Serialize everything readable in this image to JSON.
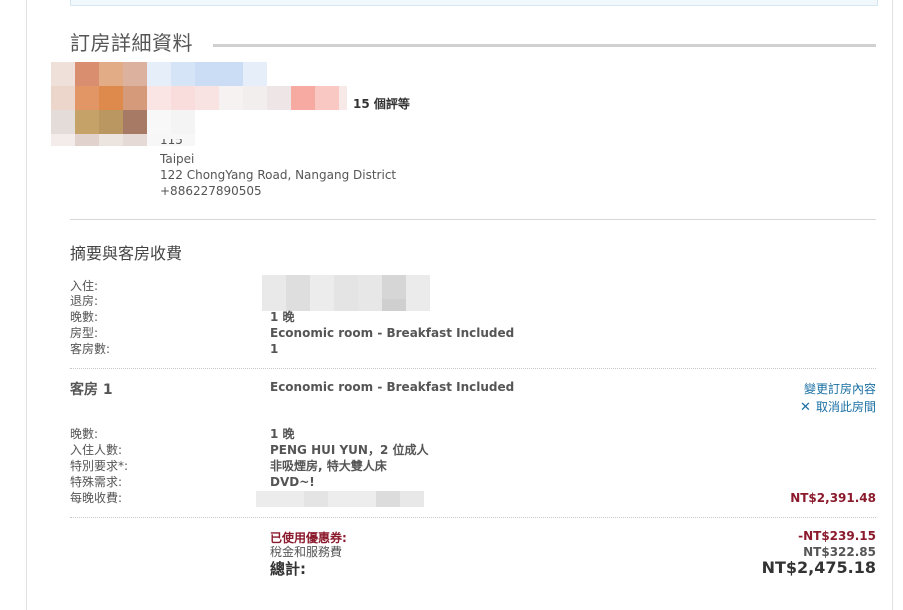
{
  "booking_details": {
    "title": "訂房詳細資料",
    "hotel": {
      "reviews": "15 個評等",
      "city": "Taipei",
      "address": "122 ChongYang Road, Nangang District",
      "phone": "+886227890505",
      "partial_line": "115"
    }
  },
  "summary": {
    "title": "摘要與客房收費",
    "labels": {
      "checkin": "入住:",
      "checkout": "退房:",
      "nights": "晚數:",
      "room_type": "房型:",
      "rooms": "客房數:"
    },
    "values": {
      "nights": "1 晚",
      "room_type": "Economic room - Breakfast Included",
      "rooms": "1"
    }
  },
  "room": {
    "heading": "客房 1",
    "type": "Economic room - Breakfast Included",
    "change_link": "變更訂房內容",
    "cancel_link": "取消此房間",
    "labels": {
      "nights": "晚數:",
      "guests": "入住人數:",
      "special": "特別要求*:",
      "special_needs": "特殊需求:",
      "nightly_rate": "每晚收費:"
    },
    "values": {
      "nights": "1 晚",
      "guests": "PENG HUI YUN，2 位成人",
      "special": "非吸煙房, 特大雙人床",
      "special_needs": "DVD~!",
      "nightly_rate": "NT$2,391.48"
    }
  },
  "totals": {
    "coupon_label": "已使用優惠券:",
    "coupon_value": "-NT$239.15",
    "tax_label": "稅金和服務費",
    "tax_value": "NT$322.85",
    "total_label": "總計:",
    "total_value": "NT$2,475.18"
  },
  "colors": {
    "link": "#1a6fa3",
    "price": "#8b1a2c",
    "rule": "#d0d0d0"
  }
}
